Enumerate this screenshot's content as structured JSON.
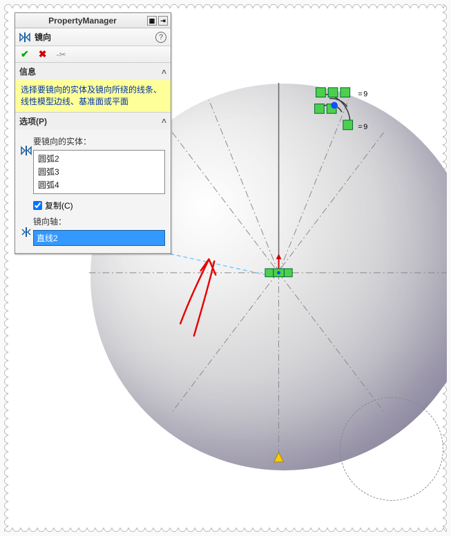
{
  "panel": {
    "title": "PropertyManager",
    "commandName": "镜向",
    "okTooltip": "确定",
    "cancelTooltip": "取消",
    "pinTooltip": "保持可见",
    "helpTooltip": "帮助"
  },
  "infoSection": {
    "header": "信息",
    "text": "选择要镜向的实体及镜向所绕的线条、线性模型边线、基准面或平面"
  },
  "optionsSection": {
    "header": "选项(P)",
    "entitiesLabel": "要镜向的实体：",
    "entities": [
      "圆弧2",
      "圆弧3",
      "圆弧4"
    ],
    "copyLabel": "复制(C)",
    "copyChecked": true,
    "axisLabel": "镜向轴：",
    "axisValue": "直线2"
  },
  "constraints": {
    "equalLabel1": "9",
    "equalLabel2": "9"
  }
}
